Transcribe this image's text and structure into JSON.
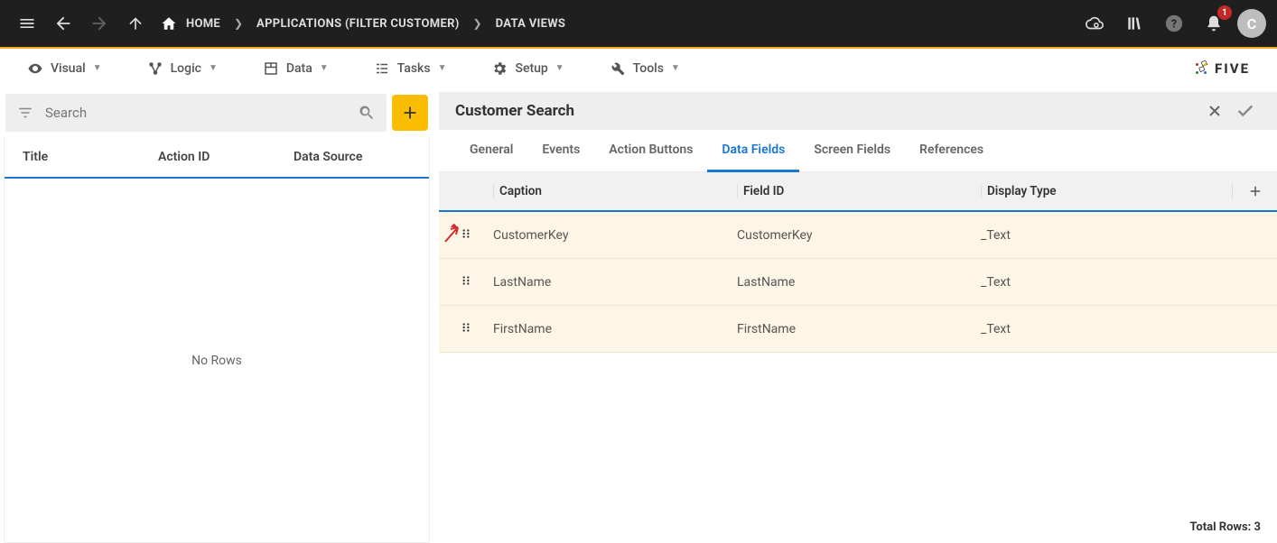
{
  "topbar": {
    "breadcrumbs": [
      "HOME",
      "APPLICATIONS (FILTER CUSTOMER)",
      "DATA VIEWS"
    ],
    "notification_count": "1",
    "avatar_initial": "C"
  },
  "menubar": {
    "items": [
      {
        "label": "Visual"
      },
      {
        "label": "Logic"
      },
      {
        "label": "Data"
      },
      {
        "label": "Tasks"
      },
      {
        "label": "Setup"
      },
      {
        "label": "Tools"
      }
    ],
    "logo": "FIVE"
  },
  "leftpane": {
    "search_placeholder": "Search",
    "columns": [
      "Title",
      "Action ID",
      "Data Source"
    ],
    "empty_text": "No Rows"
  },
  "rightpane": {
    "title": "Customer Search",
    "tabs": [
      "General",
      "Events",
      "Action Buttons",
      "Data Fields",
      "Screen Fields",
      "References"
    ],
    "active_tab": "Data Fields",
    "columns": [
      "Caption",
      "Field ID",
      "Display Type"
    ],
    "rows": [
      {
        "caption": "CustomerKey",
        "field_id": "CustomerKey",
        "display_type": "_Text"
      },
      {
        "caption": "LastName",
        "field_id": "LastName",
        "display_type": "_Text"
      },
      {
        "caption": "FirstName",
        "field_id": "FirstName",
        "display_type": "_Text"
      }
    ],
    "footer": "Total Rows: 3"
  }
}
